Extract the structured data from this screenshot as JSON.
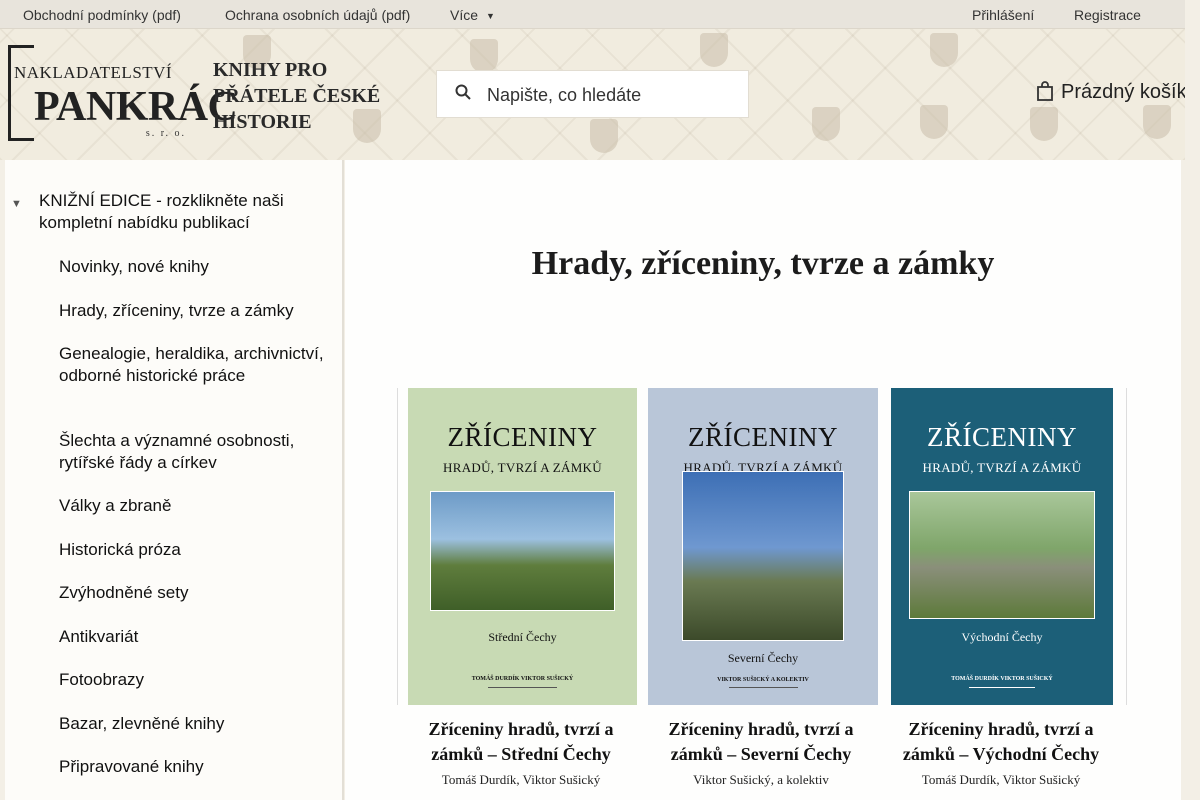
{
  "topbar": {
    "terms": "Obchodní podmínky (pdf)",
    "privacy": "Ochrana osobních údajů (pdf)",
    "more": "Více",
    "login": "Přihlášení",
    "register": "Registrace"
  },
  "header": {
    "logo_small": "NAKLADATELSTVÍ",
    "logo_big": "PANKRÁC",
    "logo_sro": "s. r. o.",
    "slogan": "KNIHY PRO PŘÁTELE ČESKÉ HISTORIE",
    "search_placeholder": "Napište, co hledáte",
    "cart": "Prázdný košík"
  },
  "sidebar": {
    "heading": "KNIŽNÍ EDICE - rozklikněte naši kompletní nabídku publikací",
    "items": [
      {
        "label": "Novinky, nové knihy"
      },
      {
        "label": "Hrady, zříceniny, tvrze a zámky"
      },
      {
        "label": "Genealogie, heraldika, archivnictví, odborné historické práce"
      },
      {
        "label": "Šlechta a významné osobnosti, rytířské řády a církev"
      },
      {
        "label": "Války a zbraně"
      },
      {
        "label": "Historická próza"
      },
      {
        "label": "Zvýhodněné sety"
      },
      {
        "label": "Antikvariát"
      },
      {
        "label": "Fotoobrazy"
      },
      {
        "label": "Bazar, zlevněné knihy"
      },
      {
        "label": "Připravované knihy"
      }
    ]
  },
  "main": {
    "title": "Hrady, zříceniny, tvrze a zámky"
  },
  "books": [
    {
      "cover_title": "ZŘÍCENINY",
      "cover_subtitle": "HRADŮ, TVRZÍ A ZÁMKŮ",
      "cover_region": "Střední Čechy",
      "cover_authors": "TOMÁŠ DURDÍK VIKTOR SUŠICKÝ",
      "name": "Zříceniny hradů, tvrzí a zámků – Střední Čechy",
      "authors": "Tomáš Durdík, Viktor Sušický",
      "cover_color": "#c8dab4"
    },
    {
      "cover_title": "ZŘÍCENINY",
      "cover_subtitle": "HRADŮ, TVRZÍ A ZÁMKŮ",
      "cover_region": "Severní Čechy",
      "cover_authors": "VIKTOR SUŠICKÝ A KOLEKTIV",
      "name": "Zříceniny hradů, tvrzí a zámků – Severní Čechy",
      "authors": "Viktor Sušický, a kolektiv",
      "cover_color": "#b9c6d8"
    },
    {
      "cover_title": "ZŘÍCENINY",
      "cover_subtitle": "HRADŮ, TVRZÍ A ZÁMKŮ",
      "cover_region": "Východní Čechy",
      "cover_authors": "TOMÁŠ DURDÍK VIKTOR SUŠICKÝ",
      "name": "Zříceniny hradů, tvrzí a zámků – Východní Čechy",
      "authors": "Tomáš Durdík, Viktor Sušický",
      "cover_color": "#1c5f78"
    }
  ]
}
